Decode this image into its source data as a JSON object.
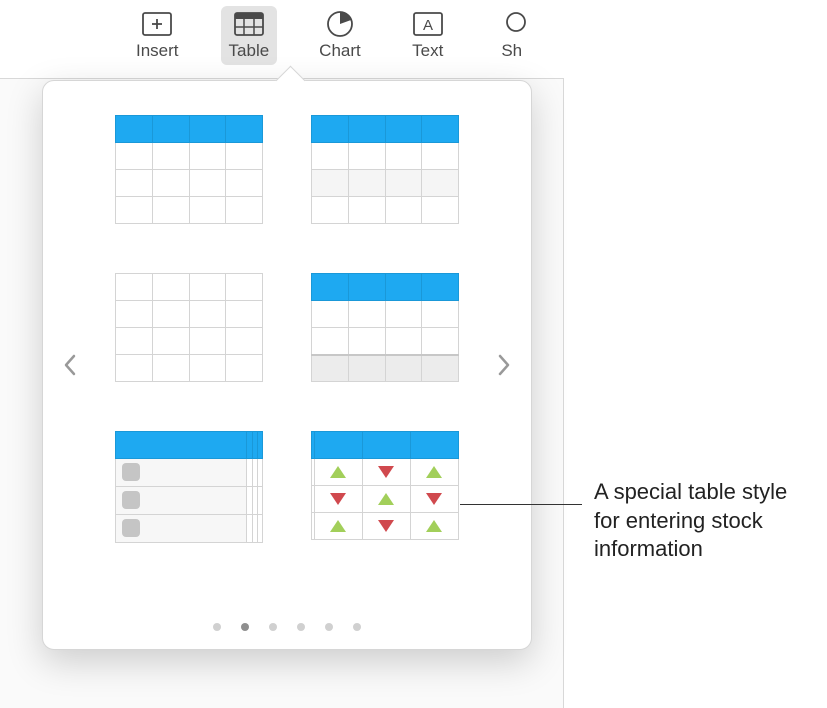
{
  "toolbar": {
    "items": [
      {
        "label": "Insert"
      },
      {
        "label": "Table"
      },
      {
        "label": "Chart"
      },
      {
        "label": "Text"
      },
      {
        "label": "Sh"
      }
    ],
    "selected_index": 1
  },
  "popover": {
    "pages": 6,
    "active_page": 1,
    "thumbnails": [
      {
        "id": "table-style-header-basic"
      },
      {
        "id": "table-style-header-alt"
      },
      {
        "id": "table-style-plain"
      },
      {
        "id": "table-style-header-footer"
      },
      {
        "id": "table-style-checklist"
      },
      {
        "id": "table-style-stock"
      }
    ]
  },
  "callout": {
    "text": "A special table style for entering stock information"
  },
  "icons": {
    "insert": "insert",
    "table": "table",
    "chart": "chart",
    "text": "text",
    "shape": "shape"
  }
}
